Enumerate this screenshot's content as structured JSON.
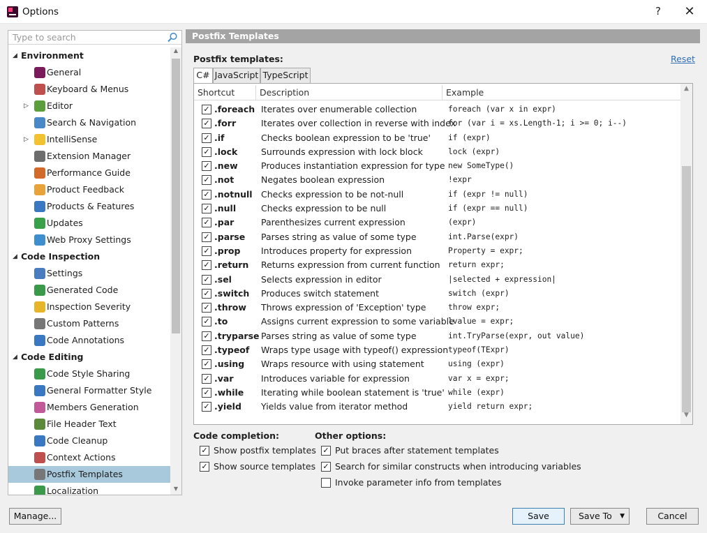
{
  "window": {
    "title": "Options",
    "help": "?",
    "close": "✕"
  },
  "search": {
    "placeholder": "Type to search"
  },
  "tree": [
    {
      "type": "section",
      "label": "Environment",
      "expander": "◢"
    },
    {
      "type": "child",
      "label": "General",
      "icon": "resharper-icon",
      "color": "#7a1c5c"
    },
    {
      "type": "child",
      "label": "Keyboard & Menus",
      "icon": "keyboard-icon",
      "color": "#c0504d"
    },
    {
      "type": "child",
      "label": "Editor",
      "icon": "pencil-icon",
      "color": "#5b9e3b",
      "expander": "▷"
    },
    {
      "type": "child",
      "label": "Search & Navigation",
      "icon": "magnifier-icon",
      "color": "#4a89c8"
    },
    {
      "type": "child",
      "label": "IntelliSense",
      "icon": "lightbulb-icon",
      "color": "#f2c230",
      "expander": "▷"
    },
    {
      "type": "child",
      "label": "Extension Manager",
      "icon": "puzzle-icon",
      "color": "#6d6d6d"
    },
    {
      "type": "child",
      "label": "Performance Guide",
      "icon": "rocket-icon",
      "color": "#d46a2a"
    },
    {
      "type": "child",
      "label": "Product Feedback",
      "icon": "envelope-icon",
      "color": "#e8a33b"
    },
    {
      "type": "child",
      "label": "Products & Features",
      "icon": "grid-icon",
      "color": "#3a78c2"
    },
    {
      "type": "child",
      "label": "Updates",
      "icon": "update-icon",
      "color": "#3aa14a"
    },
    {
      "type": "child",
      "label": "Web Proxy Settings",
      "icon": "globe-icon",
      "color": "#3f8fcf"
    },
    {
      "type": "section",
      "label": "Code Inspection",
      "expander": "◢"
    },
    {
      "type": "child",
      "label": "Settings",
      "icon": "person-icon",
      "color": "#4a7cc0"
    },
    {
      "type": "child",
      "label": "Generated Code",
      "icon": "code-file-icon",
      "color": "#3a9a4a"
    },
    {
      "type": "child",
      "label": "Inspection Severity",
      "icon": "severity-icon",
      "color": "#e7b52a"
    },
    {
      "type": "child",
      "label": "Custom Patterns",
      "icon": "pattern-icon",
      "color": "#777777"
    },
    {
      "type": "child",
      "label": "Code Annotations",
      "icon": "annotation-icon",
      "color": "#3a78c2"
    },
    {
      "type": "section",
      "label": "Code Editing",
      "expander": "◢"
    },
    {
      "type": "child",
      "label": "Code Style Sharing",
      "icon": "share-icon",
      "color": "#3a9a4a"
    },
    {
      "type": "child",
      "label": "General Formatter Style",
      "icon": "formatter-icon",
      "color": "#3a78c2"
    },
    {
      "type": "child",
      "label": "Members Generation",
      "icon": "members-icon",
      "color": "#c25a9a"
    },
    {
      "type": "child",
      "label": "File Header Text",
      "icon": "file-header-icon",
      "color": "#5c8a3a"
    },
    {
      "type": "child",
      "label": "Code Cleanup",
      "icon": "cleanup-icon",
      "color": "#3a78c2"
    },
    {
      "type": "child",
      "label": "Context Actions",
      "icon": "wrench-icon",
      "color": "#c0504d"
    },
    {
      "type": "child",
      "label": "Postfix Templates",
      "icon": "postfix-icon",
      "color": "#777777",
      "selected": true
    },
    {
      "type": "child",
      "label": "Localization",
      "icon": "localization-icon",
      "color": "#3a9a4a"
    }
  ],
  "panel": {
    "header": "Postfix Templates",
    "section_title": "Postfix templates:",
    "reset": "Reset",
    "tabs": [
      "C#",
      "JavaScript",
      "TypeScript"
    ],
    "columns": [
      "Shortcut",
      "Description",
      "Example"
    ]
  },
  "templates": [
    {
      "shortcut": ".foreach",
      "description": "Iterates over enumerable collection",
      "example": "foreach (var x in expr)"
    },
    {
      "shortcut": ".forr",
      "description": "Iterates over collection in reverse with index",
      "example": "for (var i = xs.Length-1; i >= 0; i--)"
    },
    {
      "shortcut": ".if",
      "description": "Checks boolean expression to be 'true'",
      "example": "if (expr)"
    },
    {
      "shortcut": ".lock",
      "description": "Surrounds expression with lock block",
      "example": "lock (expr)"
    },
    {
      "shortcut": ".new",
      "description": "Produces instantiation expression for type",
      "example": "new SomeType()"
    },
    {
      "shortcut": ".not",
      "description": "Negates boolean expression",
      "example": "!expr"
    },
    {
      "shortcut": ".notnull",
      "description": "Checks expression to be not-null",
      "example": "if (expr != null)"
    },
    {
      "shortcut": ".null",
      "description": "Checks expression to be null",
      "example": "if (expr == null)"
    },
    {
      "shortcut": ".par",
      "description": "Parenthesizes current expression",
      "example": "(expr)"
    },
    {
      "shortcut": ".parse",
      "description": "Parses string as value of some type",
      "example": "int.Parse(expr)"
    },
    {
      "shortcut": ".prop",
      "description": "Introduces property for expression",
      "example": "Property = expr;"
    },
    {
      "shortcut": ".return",
      "description": "Returns expression from current function",
      "example": "return expr;"
    },
    {
      "shortcut": ".sel",
      "description": "Selects expression in editor",
      "example": "|selected + expression|"
    },
    {
      "shortcut": ".switch",
      "description": "Produces switch statement",
      "example": "switch (expr)"
    },
    {
      "shortcut": ".throw",
      "description": "Throws expression of 'Exception' type",
      "example": "throw expr;"
    },
    {
      "shortcut": ".to",
      "description": "Assigns current expression to some variable",
      "example": "lvalue = expr;"
    },
    {
      "shortcut": ".tryparse",
      "description": "Parses string as value of some type",
      "example": "int.TryParse(expr, out value)"
    },
    {
      "shortcut": ".typeof",
      "description": "Wraps type usage with typeof() expression",
      "example": "typeof(TExpr)"
    },
    {
      "shortcut": ".using",
      "description": "Wraps resource with using statement",
      "example": "using (expr)"
    },
    {
      "shortcut": ".var",
      "description": "Introduces variable for expression",
      "example": "var x = expr;"
    },
    {
      "shortcut": ".while",
      "description": "Iterating while boolean statement is 'true'",
      "example": "while (expr)"
    },
    {
      "shortcut": ".yield",
      "description": "Yields value from iterator method",
      "example": "yield return expr;"
    }
  ],
  "code_completion": {
    "title": "Code completion:",
    "options": [
      {
        "label": "Show postfix templates",
        "checked": true
      },
      {
        "label": "Show source templates",
        "checked": true
      }
    ]
  },
  "other_options": {
    "title": "Other options:",
    "options": [
      {
        "label": "Put braces after statement templates",
        "checked": true
      },
      {
        "label": "Search for similar constructs when introducing variables",
        "checked": true
      },
      {
        "label": "Invoke parameter info from templates",
        "checked": false
      }
    ]
  },
  "buttons": {
    "manage": "Manage...",
    "save": "Save",
    "save_to": "Save To",
    "save_to_caret": "▼",
    "cancel": "Cancel"
  },
  "glyphs": {
    "check": "✓",
    "scroll_up": "▲",
    "scroll_down": "▼"
  }
}
